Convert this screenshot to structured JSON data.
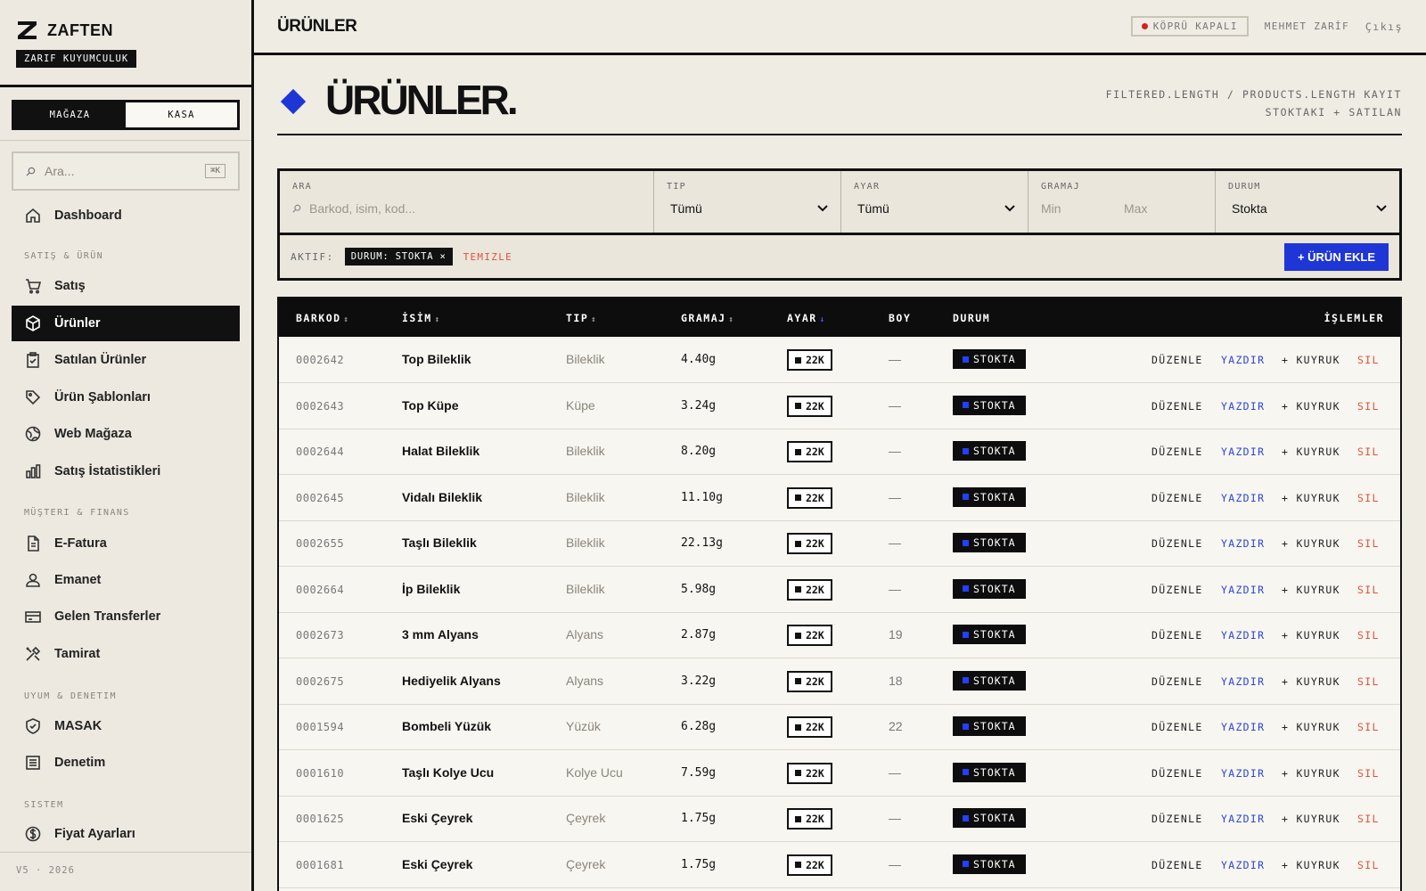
{
  "brand": {
    "name": "ZAFTEN",
    "subtitle": "ZARIF KUYUMCULUK"
  },
  "mode_toggle": {
    "store_label": "MAĞAZA",
    "register_label": "KASA"
  },
  "sidebar_search": {
    "placeholder": "Ara...",
    "shortcut": "⌘K"
  },
  "nav": {
    "dashboard": "Dashboard",
    "group_sales": "SATIŞ & ÜRÜN",
    "sales": "Satış",
    "products": "Ürünler",
    "sold_products": "Satılan Ürünler",
    "templates": "Ürün Şablonları",
    "web_store": "Web Mağaza",
    "sales_stats": "Satış İstatistikleri",
    "group_customer": "MÜŞTERI & FINANS",
    "einvoice": "E-Fatura",
    "consignment": "Emanet",
    "transfers": "Gelen Transferler",
    "repair": "Tamirat",
    "group_compliance": "UYUM & DENETIM",
    "masak": "MASAK",
    "audit": "Denetim",
    "group_system": "SISTEM",
    "price_settings": "Fiyat Ayarları"
  },
  "version": "V5 · 2026",
  "topbar": {
    "title": "ÜRÜNLER",
    "bridge_status": "KÖPRÜ KAPALI",
    "user": "MEHMET ZARİF",
    "logout": "Çıkış"
  },
  "page": {
    "title": "ÜRÜNLER.",
    "meta_line1": "FILTERED.LENGTH / PRODUCTS.LENGTH KAYIT",
    "meta_line2": "STOKTAKI + SATILAN"
  },
  "filters": {
    "search_label": "ARA",
    "search_placeholder": "Barkod, isim, kod...",
    "type_label": "TIP",
    "type_value": "Tümü",
    "karat_label": "AYAR",
    "karat_value": "Tümü",
    "weight_label": "GRAMAJ",
    "weight_min": "Min",
    "weight_max": "Max",
    "status_label": "DURUM",
    "status_value": "Stokta",
    "active_label": "AKTIF:",
    "active_chip": "DURUM: STOKTA ×",
    "clear": "TEMIZLE",
    "add_button": "+ ÜRÜN EKLE"
  },
  "table": {
    "headers": {
      "barcode": "BARKOD",
      "name": "İSİM",
      "type": "TIP",
      "weight": "GRAMAJ",
      "karat": "AYAR",
      "size": "BOY",
      "status": "DURUM",
      "actions": "İŞLEMLER"
    },
    "sort_both": "↕",
    "sort_down": "↓",
    "actions": {
      "edit": "DÜZENLE",
      "print": "YAZDIR",
      "queue": "+ KUYRUK",
      "delete": "SIL"
    },
    "rows": [
      {
        "barcode": "0002642",
        "name": "Top Bileklik",
        "type": "Bileklik",
        "weight": "4.40g",
        "karat": "22K",
        "size": "—",
        "status": "STOKTA"
      },
      {
        "barcode": "0002643",
        "name": "Top Küpe",
        "type": "Küpe",
        "weight": "3.24g",
        "karat": "22K",
        "size": "—",
        "status": "STOKTA"
      },
      {
        "barcode": "0002644",
        "name": "Halat Bileklik",
        "type": "Bileklik",
        "weight": "8.20g",
        "karat": "22K",
        "size": "—",
        "status": "STOKTA"
      },
      {
        "barcode": "0002645",
        "name": "Vidalı Bileklik",
        "type": "Bileklik",
        "weight": "11.10g",
        "karat": "22K",
        "size": "—",
        "status": "STOKTA"
      },
      {
        "barcode": "0002655",
        "name": "Taşlı Bileklik",
        "type": "Bileklik",
        "weight": "22.13g",
        "karat": "22K",
        "size": "—",
        "status": "STOKTA"
      },
      {
        "barcode": "0002664",
        "name": "İp Bileklik",
        "type": "Bileklik",
        "weight": "5.98g",
        "karat": "22K",
        "size": "—",
        "status": "STOKTA"
      },
      {
        "barcode": "0002673",
        "name": "3 mm Alyans",
        "type": "Alyans",
        "weight": "2.87g",
        "karat": "22K",
        "size": "19",
        "status": "STOKTA"
      },
      {
        "barcode": "0002675",
        "name": "Hediyelik Alyans",
        "type": "Alyans",
        "weight": "3.22g",
        "karat": "22K",
        "size": "18",
        "status": "STOKTA"
      },
      {
        "barcode": "0001594",
        "name": "Bombeli Yüzük",
        "type": "Yüzük",
        "weight": "6.28g",
        "karat": "22K",
        "size": "22",
        "status": "STOKTA"
      },
      {
        "barcode": "0001610",
        "name": "Taşlı Kolye Ucu",
        "type": "Kolye Ucu",
        "weight": "7.59g",
        "karat": "22K",
        "size": "—",
        "status": "STOKTA"
      },
      {
        "barcode": "0001625",
        "name": "Eski Çeyrek",
        "type": "Çeyrek",
        "weight": "1.75g",
        "karat": "22K",
        "size": "—",
        "status": "STOKTA"
      },
      {
        "barcode": "0001681",
        "name": "Eski Çeyrek",
        "type": "Çeyrek",
        "weight": "1.75g",
        "karat": "22K",
        "size": "—",
        "status": "STOKTA"
      }
    ]
  },
  "colors": {
    "accent": "#1f36d6",
    "danger": "#e0533a",
    "background": "#efece4",
    "ink": "#111111"
  }
}
